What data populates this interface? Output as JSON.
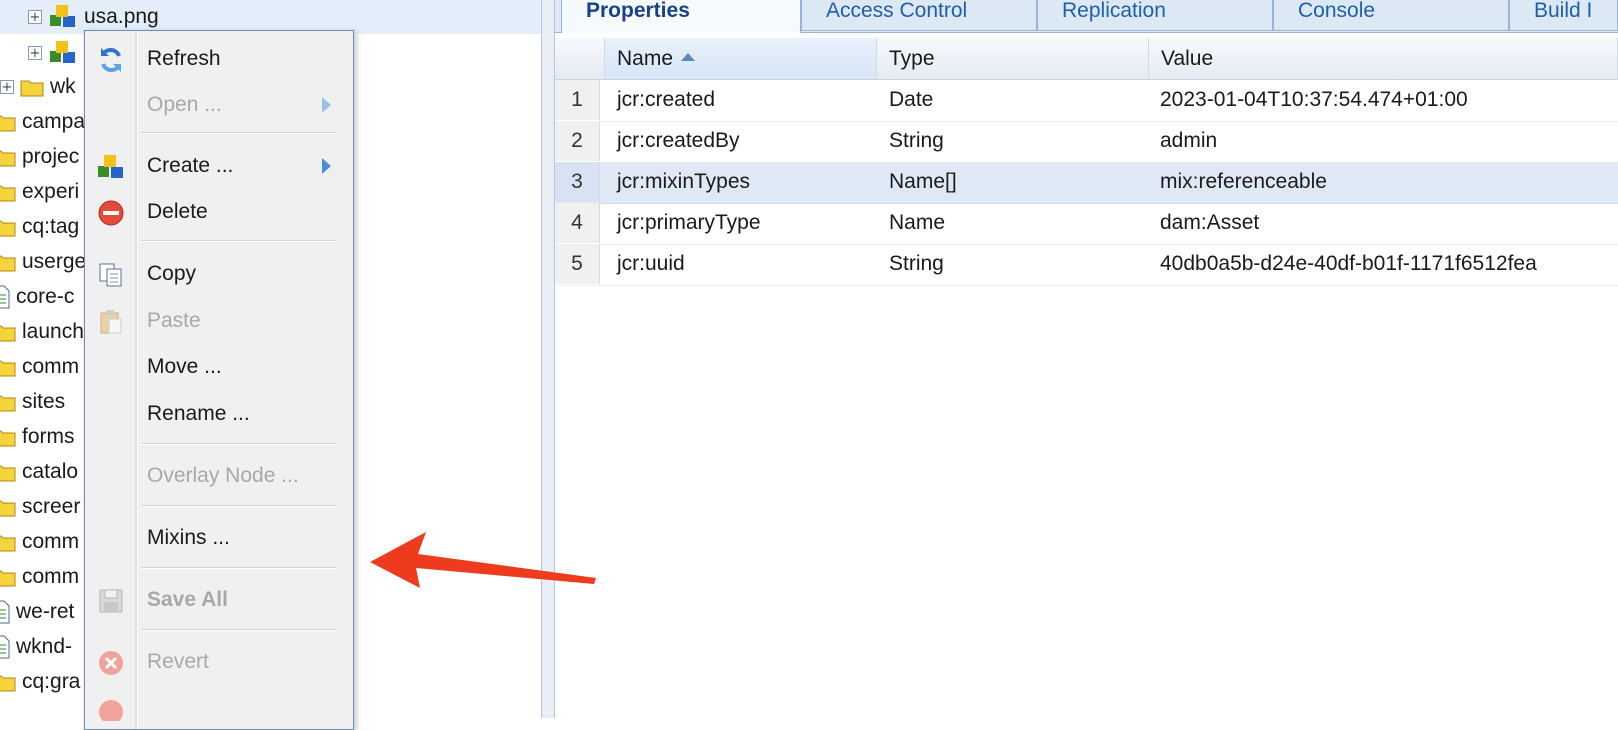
{
  "tree": {
    "items": [
      {
        "label": "usa.png",
        "kind": "asset",
        "expandable": true,
        "selected": true
      },
      {
        "label": "",
        "kind": "asset",
        "expandable": true
      },
      {
        "label": "wk",
        "kind": "folder",
        "expandable": true
      },
      {
        "label": "campa",
        "kind": "folder"
      },
      {
        "label": "projec",
        "kind": "folder"
      },
      {
        "label": "experi",
        "kind": "folder"
      },
      {
        "label": "cq:tag",
        "kind": "folder"
      },
      {
        "label": "userge",
        "kind": "folder"
      },
      {
        "label": "core-c",
        "kind": "file"
      },
      {
        "label": "launch",
        "kind": "folder"
      },
      {
        "label": "comm",
        "kind": "folder"
      },
      {
        "label": "sites",
        "kind": "folder"
      },
      {
        "label": "forms",
        "kind": "folder"
      },
      {
        "label": "catalo",
        "kind": "folder"
      },
      {
        "label": "screer",
        "kind": "folder"
      },
      {
        "label": "comm",
        "kind": "folder"
      },
      {
        "label": "comm",
        "kind": "folder"
      },
      {
        "label": "we-ret",
        "kind": "file"
      },
      {
        "label": "wknd-",
        "kind": "file"
      },
      {
        "label": "cq:gra",
        "kind": "folder"
      }
    ]
  },
  "context_menu": {
    "items": [
      {
        "label": "Refresh",
        "icon": "refresh-icon",
        "enabled": true
      },
      {
        "label": "Open ...",
        "icon": "",
        "enabled": false,
        "submenu": true
      },
      {
        "label": "Create ...",
        "icon": "create-node-icon",
        "enabled": true,
        "submenu": true
      },
      {
        "label": "Delete",
        "icon": "delete-icon",
        "enabled": true
      },
      {
        "label": "Copy",
        "icon": "copy-icon",
        "enabled": true
      },
      {
        "label": "Paste",
        "icon": "paste-icon",
        "enabled": false
      },
      {
        "label": "Move ...",
        "icon": "",
        "enabled": true
      },
      {
        "label": "Rename ...",
        "icon": "",
        "enabled": true
      },
      {
        "label": "Overlay Node ...",
        "icon": "",
        "enabled": false
      },
      {
        "label": "Mixins ...",
        "icon": "",
        "enabled": true
      },
      {
        "label": "Save All",
        "icon": "save-icon",
        "enabled": false,
        "bold": true
      },
      {
        "label": "Revert",
        "icon": "revert-icon",
        "enabled": false
      }
    ]
  },
  "tabs": [
    {
      "label": "Properties",
      "active": true
    },
    {
      "label": "Access Control"
    },
    {
      "label": "Replication"
    },
    {
      "label": "Console"
    },
    {
      "label": "Build I"
    }
  ],
  "grid": {
    "columns": {
      "name": "Name",
      "type": "Type",
      "value": "Value"
    },
    "sorted_by": "Name",
    "rows": [
      {
        "num": "1",
        "name": "jcr:created",
        "type": "Date",
        "value": "2023-01-04T10:37:54.474+01:00"
      },
      {
        "num": "2",
        "name": "jcr:createdBy",
        "type": "String",
        "value": "admin"
      },
      {
        "num": "3",
        "name": "jcr:mixinTypes",
        "type": "Name[]",
        "value": "mix:referenceable",
        "highlighted": true
      },
      {
        "num": "4",
        "name": "jcr:primaryType",
        "type": "Name",
        "value": "dam:Asset"
      },
      {
        "num": "5",
        "name": "jcr:uuid",
        "type": "String",
        "value": "40db0a5b-d24e-40df-b01f-1171f6512fea"
      }
    ]
  },
  "annotation": {
    "icon": "red-arrow-pointer",
    "color": "#ee3b1e"
  },
  "colors": {
    "tab_text": "#1f5fa8",
    "selection": "#dfe9f6",
    "menu_border": "#718bb7"
  }
}
